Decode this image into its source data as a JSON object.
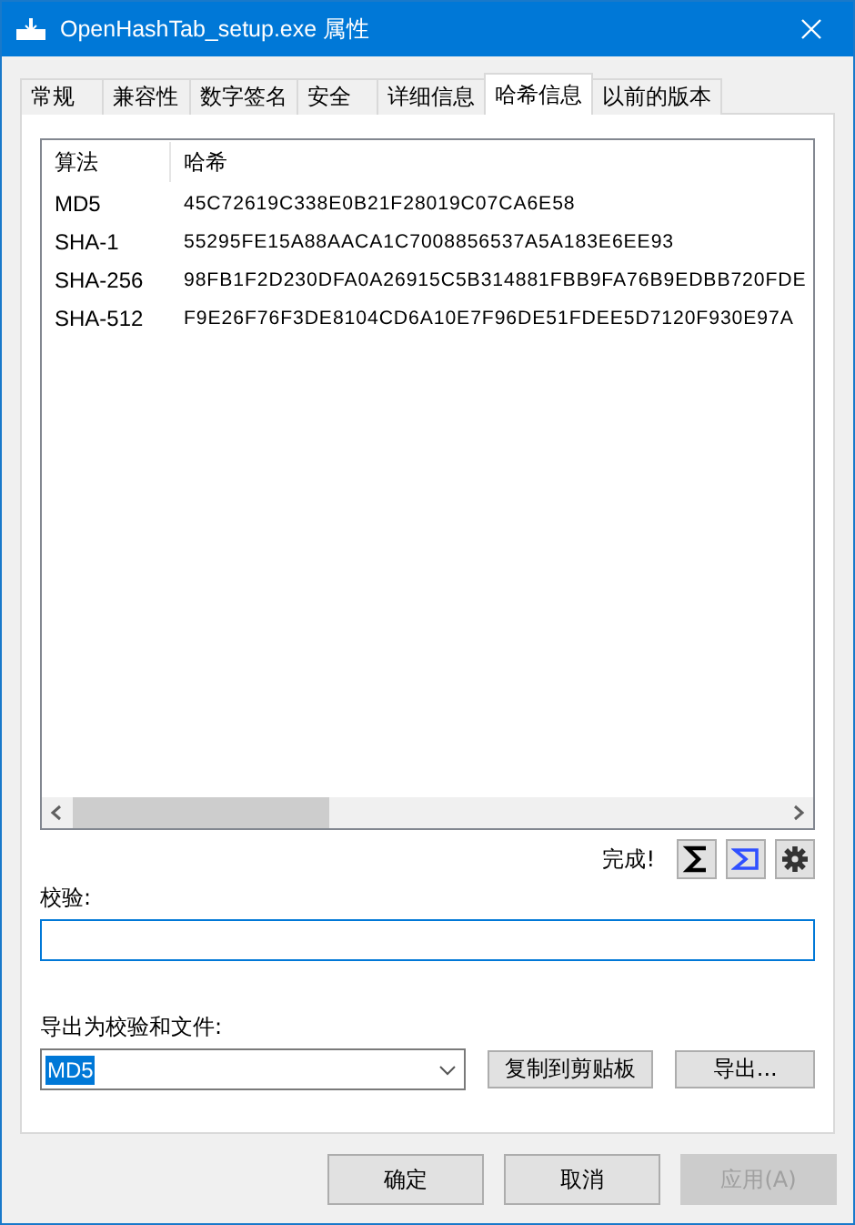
{
  "window": {
    "title": "OpenHashTab_setup.exe 属性"
  },
  "tabs": [
    {
      "label": "常规",
      "selected": false
    },
    {
      "label": "兼容性",
      "selected": false
    },
    {
      "label": "数字签名",
      "selected": false
    },
    {
      "label": "安全",
      "selected": false
    },
    {
      "label": "详细信息",
      "selected": false
    },
    {
      "label": "哈希信息",
      "selected": true
    },
    {
      "label": "以前的版本",
      "selected": false
    }
  ],
  "hash_list": {
    "columns": [
      "算法",
      "哈希"
    ],
    "rows": [
      {
        "algorithm": "MD5",
        "hash": "45C72619C338E0B21F28019C07CA6E58"
      },
      {
        "algorithm": "SHA-1",
        "hash": "55295FE15A88AACA1C7008856537A5A183E6EE93"
      },
      {
        "algorithm": "SHA-256",
        "hash": "98FB1F2D230DFA0A26915C5B314881FBB9FA76B9EDBB720FDE"
      },
      {
        "algorithm": "SHA-512",
        "hash": "F9E26F76F3DE8104CD6A10E7F96DE51FDEE5D7120F930E97A"
      }
    ]
  },
  "status": "完成!",
  "verify": {
    "label": "校验:"
  },
  "export": {
    "label": "导出为校验和文件:",
    "format": "MD5",
    "value_selected": true,
    "copy_button": "复制到剪贴板",
    "export_button": "导出..."
  },
  "buttons": [
    {
      "label": "确定",
      "disabled": false
    },
    {
      "label": "取消",
      "disabled": false
    },
    {
      "label": "应用(A)",
      "disabled": true
    }
  ]
}
